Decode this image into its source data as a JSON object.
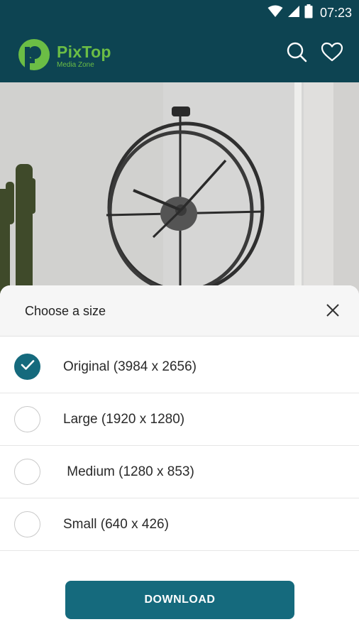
{
  "status_bar": {
    "time": "07:23"
  },
  "app_bar": {
    "logo_name": "PixTop",
    "logo_tagline": "Media Zone",
    "icons": [
      "search-icon",
      "heart-icon"
    ]
  },
  "sheet": {
    "title": "Choose a size",
    "options": [
      {
        "label": "Original (3984 x 2656)",
        "selected": true
      },
      {
        "label": "Large (1920 x 1280)",
        "selected": false
      },
      {
        "label": " Medium (1280 x 853)",
        "selected": false
      },
      {
        "label": "Small (640 x 426)",
        "selected": false
      }
    ],
    "download_label": "DOWNLOAD"
  },
  "colors": {
    "toolbar": "#0d4452",
    "accent": "#156a7d",
    "logo_green": "#6bbd45"
  }
}
